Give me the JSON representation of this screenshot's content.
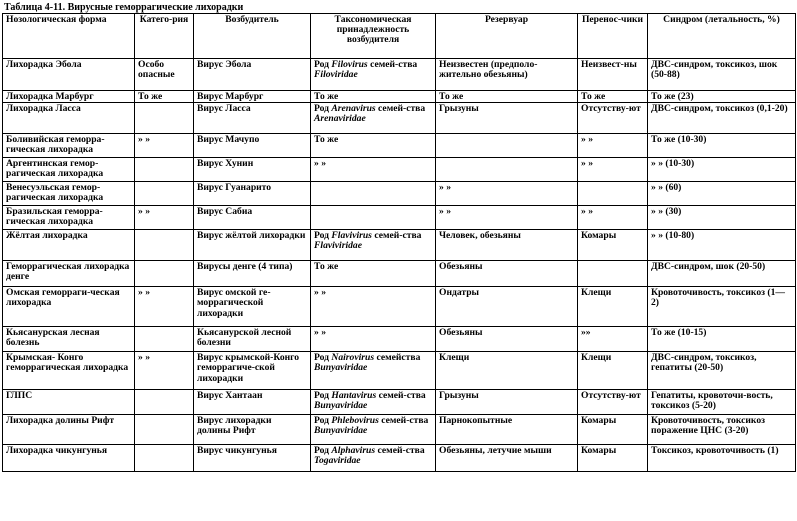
{
  "caption": "Таблица 4-11. Вирусные геморрагические лихорадки",
  "headers": [
    "Нозологическая форма",
    "Катего-рия",
    "Возбудитель",
    "Таксономическая принадлежность возбудителя",
    "Резервуар",
    "Перенос-чики",
    "Синдром (летальность, %)"
  ],
  "rows": [
    {
      "form": "Лихорадка Эбола",
      "category": "Особо опасные",
      "agent": "Вирус Эбола",
      "tax_pre": "Род ",
      "tax_genus": "Filovirus",
      "tax_mid": " семей-ства ",
      "tax_family": "Filoviridae",
      "reservoir": "Неизвестен (предполо-жительно обезьяны)",
      "carrier": "Неизвест-ны",
      "syndrome": "ДВС-синдром, токсикоз, шок (50-88)"
    },
    {
      "form": "Лихорадка Марбург",
      "category": "То же",
      "agent": "Вирус Марбург",
      "tax_pre": "То же",
      "tax_genus": "",
      "tax_mid": "",
      "tax_family": "",
      "reservoir": "То же",
      "carrier": "То же",
      "syndrome": "То же (23)"
    },
    {
      "form": "Лихорадка Ласса",
      "category": "",
      "agent": "Вирус Ласса",
      "tax_pre": "Род ",
      "tax_genus": "Arenavirus",
      "tax_mid": " семей-ства ",
      "tax_family": "Arenaviridae",
      "reservoir": "Грызуны",
      "carrier": "Отсутству-ют",
      "syndrome": "ДВС-синдром, токсикоз (0,1-20)"
    },
    {
      "form": "Боливийская геморра-гическая лихорадка",
      "category": "» »",
      "agent": "Вирус Мачупо",
      "tax_pre": "То же",
      "tax_genus": "",
      "tax_mid": "",
      "tax_family": "",
      "reservoir": "",
      "carrier": "» »",
      "syndrome": "То же (10-30)"
    },
    {
      "form": "Аргентинская гемор-рагическая лихорадка",
      "category": "",
      "agent": "Вирус Хунин",
      "tax_pre": "» »",
      "tax_genus": "",
      "tax_mid": "",
      "tax_family": "",
      "reservoir": "",
      "carrier": "» »",
      "syndrome": "» » (10-30)"
    },
    {
      "form": "Венесуэльская гемор-рагическая лихорадка",
      "category": "",
      "agent": "Вирус Гуанарито",
      "tax_pre": "",
      "tax_genus": "",
      "tax_mid": "",
      "tax_family": "",
      "reservoir": "» »",
      "carrier": "",
      "syndrome": "» » (60)"
    },
    {
      "form": "Бразильская геморра-гическая лихорадка",
      "category": "» »",
      "agent": "Вирус Сабиа",
      "tax_pre": "",
      "tax_genus": "",
      "tax_mid": "",
      "tax_family": "",
      "reservoir": "» »",
      "carrier": "» »",
      "syndrome": "» » (30)"
    },
    {
      "form": "Жёлтая лихорадка",
      "category": "",
      "agent": "Вирус жёлтой лихорадки",
      "tax_pre": "Род ",
      "tax_genus": "Flavivirus",
      "tax_mid": " семей-ства ",
      "tax_family": "Flaviviridae",
      "reservoir": "Человек, обезьяны",
      "carrier": "Комары",
      "syndrome": "» » (10-80)"
    },
    {
      "form": "Геморрагическая лихорадка денге",
      "category": "",
      "agent": "Вирусы денге (4 типа)",
      "tax_pre": "То же",
      "tax_genus": "",
      "tax_mid": "",
      "tax_family": "",
      "reservoir": "Обезьяны",
      "carrier": "",
      "syndrome": "ДВС-синдром, шок (20-50)"
    },
    {
      "form": "Омская геморраги-ческая лихорадка",
      "category": "» »",
      "agent": "Вирус омской ге-моррагической лихорадки",
      "tax_pre": "» »",
      "tax_genus": "",
      "tax_mid": "",
      "tax_family": "",
      "reservoir": "Ондатры",
      "carrier": "Клещи",
      "syndrome": "Кровоточивость, токсикоз (1—2)"
    },
    {
      "form": "Кьясанурская лесная болезнь",
      "category": "",
      "agent": "Кьясанурской лесной болезни",
      "tax_pre": "» »",
      "tax_genus": "",
      "tax_mid": "",
      "tax_family": "",
      "reservoir": "Обезьяны",
      "carrier": "»»",
      "syndrome": "То же (10-15)"
    },
    {
      "form": "Крымская- Конго геморрагическая лихорадка",
      "category": "» »",
      "agent": "Вирус крымской-Конго геморрагиче-ской лихорадки",
      "tax_pre": "Род ",
      "tax_genus": "Nairovirus",
      "tax_mid": " семейства ",
      "tax_family": "Bunyaviridae",
      "reservoir": "Клещи",
      "carrier": "Клещи",
      "syndrome": "ДВС-синдром, токсикоз, гепатиты (20-50)"
    },
    {
      "form": "ГЛПС",
      "category": "",
      "agent": "Вирус Хантаан",
      "tax_pre": "Род ",
      "tax_genus": "Hantavirus",
      "tax_mid": " семей-ства ",
      "tax_family": "Bunyaviridae",
      "reservoir": "Грызуны",
      "carrier": "Отсутству-ют",
      "syndrome": "Гепатиты, кровоточи-вость, токсикоз (5-20)"
    },
    {
      "form": "Лихорадка долины Рифт",
      "category": "",
      "agent": "Вирус лихорадки долины Рифт",
      "tax_pre": "Род ",
      "tax_genus": "Phlebovirus",
      "tax_mid": " семей-ства ",
      "tax_family": "Bunyaviridae",
      "reservoir": "Парнокопытные",
      "carrier": "Комары",
      "syndrome": "Кровоточивость, токсикоз поражение ЦНС (3-20)"
    },
    {
      "form": "Лихорадка чикунгунья",
      "category": "",
      "agent": "Вирус чикунгунья",
      "tax_pre": "Род ",
      "tax_genus": "Alphavirus",
      "tax_mid": " семей-ства ",
      "tax_family": "Togaviridae",
      "reservoir": "Обезьяны, летучие мыши",
      "carrier": "Комары",
      "syndrome": "Токсикоз, кровоточивость (1)"
    }
  ]
}
